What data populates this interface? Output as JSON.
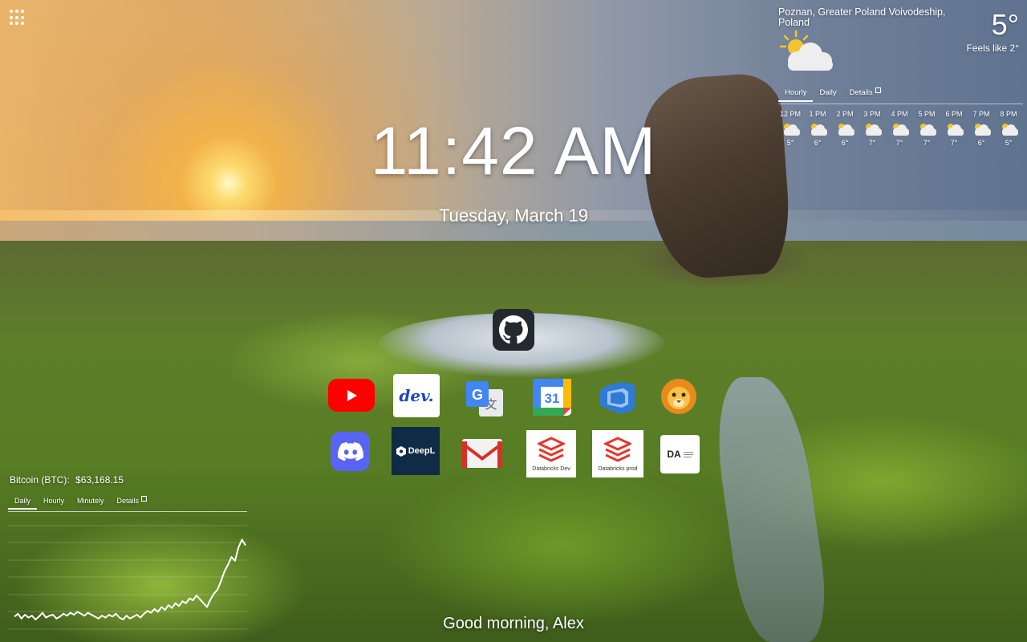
{
  "clock": {
    "time": "11:42 AM",
    "date": "Tuesday, March 19"
  },
  "greeting": "Good morning, Alex",
  "weather": {
    "location": "Poznan, Greater Poland Voivodeship, Poland",
    "temperature": "5°",
    "feels_like": "Feels like 2°",
    "icon": "partly-cloudy-icon",
    "tabs": [
      "Hourly",
      "Daily",
      "Details"
    ],
    "active_tab": "Hourly",
    "hourly": [
      {
        "time": "12 PM",
        "temp": "5°",
        "icon": "partly-cloudy-icon"
      },
      {
        "time": "1 PM",
        "temp": "6°",
        "icon": "partly-cloudy-icon"
      },
      {
        "time": "2 PM",
        "temp": "6°",
        "icon": "partly-cloudy-icon"
      },
      {
        "time": "3 PM",
        "temp": "7°",
        "icon": "partly-cloudy-icon"
      },
      {
        "time": "4 PM",
        "temp": "7°",
        "icon": "partly-cloudy-icon"
      },
      {
        "time": "5 PM",
        "temp": "7°",
        "icon": "partly-cloudy-icon"
      },
      {
        "time": "6 PM",
        "temp": "7°",
        "icon": "partly-cloudy-icon"
      },
      {
        "time": "7 PM",
        "temp": "6°",
        "icon": "partly-cloudy-icon"
      },
      {
        "time": "8 PM",
        "temp": "5°",
        "icon": "partly-cloudy-icon"
      }
    ]
  },
  "bitcoin": {
    "label": "Bitcoin (BTC):",
    "price": "$63,168.15",
    "tabs": [
      "Daily",
      "Hourly",
      "Minutely",
      "Details"
    ],
    "active_tab": "Daily",
    "series": [
      0.08,
      0.11,
      0.06,
      0.1,
      0.07,
      0.09,
      0.05,
      0.08,
      0.12,
      0.07,
      0.09,
      0.1,
      0.06,
      0.08,
      0.11,
      0.09,
      0.12,
      0.1,
      0.13,
      0.11,
      0.09,
      0.12,
      0.1,
      0.08,
      0.06,
      0.09,
      0.07,
      0.1,
      0.08,
      0.11,
      0.07,
      0.05,
      0.09,
      0.06,
      0.08,
      0.1,
      0.07,
      0.11,
      0.14,
      0.12,
      0.16,
      0.13,
      0.18,
      0.15,
      0.2,
      0.17,
      0.22,
      0.19,
      0.24,
      0.22,
      0.27,
      0.25,
      0.3,
      0.26,
      0.22,
      0.18,
      0.26,
      0.32,
      0.36,
      0.45,
      0.55,
      0.62,
      0.7,
      0.66,
      0.8,
      0.88,
      0.82
    ]
  },
  "shortcuts": {
    "row1": [
      {
        "name": "GitHub",
        "icon": "github-icon"
      }
    ],
    "row2": [
      {
        "name": "YouTube",
        "icon": "youtube-icon"
      },
      {
        "name": "DEV Community",
        "icon": "dev-icon",
        "text": "dev."
      },
      {
        "name": "Google Translate",
        "icon": "google-translate-icon"
      },
      {
        "name": "Google Calendar",
        "icon": "google-calendar-icon",
        "text": "31"
      },
      {
        "name": "Azure DevOps",
        "icon": "azure-devops-icon"
      },
      {
        "name": "Lion app",
        "icon": "lion-icon"
      }
    ],
    "row3": [
      {
        "name": "Discord",
        "icon": "discord-icon"
      },
      {
        "name": "DeepL",
        "icon": "deepl-icon",
        "text": "DeepL"
      },
      {
        "name": "Gmail",
        "icon": "gmail-icon"
      },
      {
        "name": "Databricks Dev",
        "icon": "databricks-icon",
        "text": "Databricks Dev"
      },
      {
        "name": "Databricks prod",
        "icon": "databricks-icon",
        "text": "Databricks prod"
      },
      {
        "name": "DA",
        "icon": "da-icon",
        "text": "DA"
      }
    ]
  },
  "colors": {
    "accent": "#ffffff",
    "youtube": "#ff0000",
    "discord": "#5865f2",
    "databricks": "#e8352a",
    "deepl": "#0f2b46"
  }
}
